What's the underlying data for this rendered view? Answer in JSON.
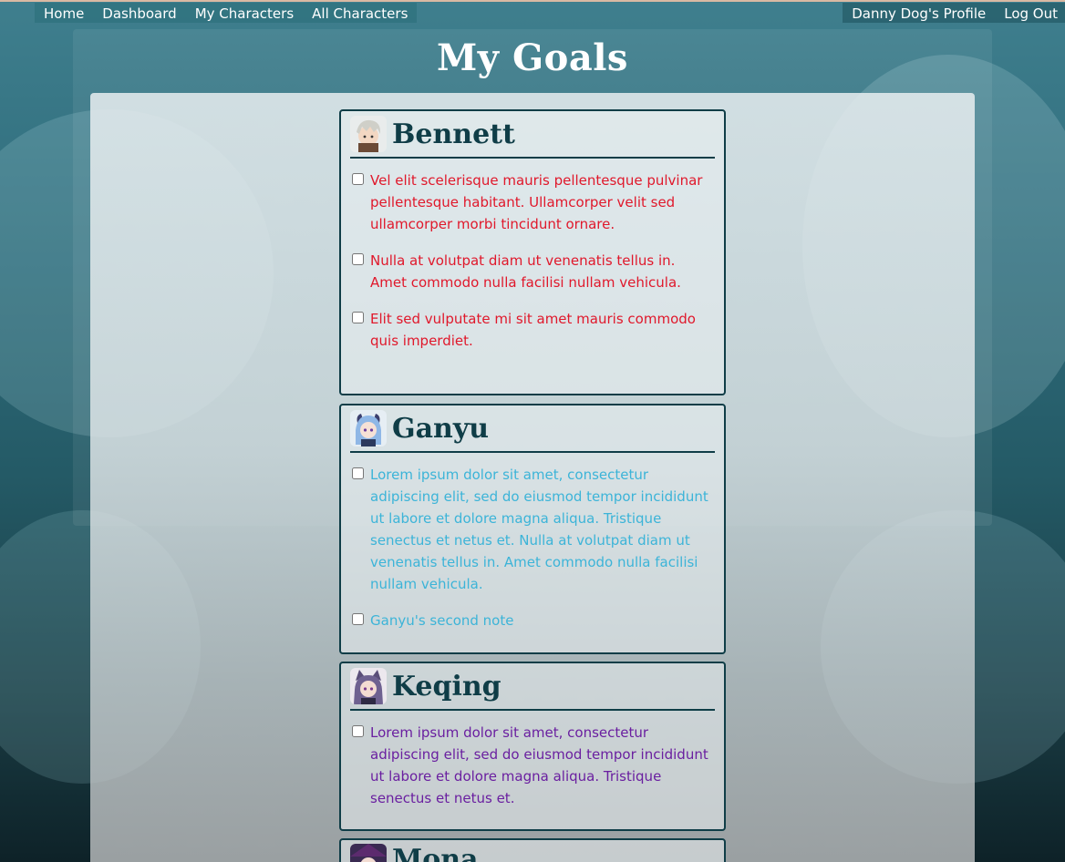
{
  "nav": {
    "left": [
      {
        "label": "Home"
      },
      {
        "label": "Dashboard"
      },
      {
        "label": "My Characters"
      },
      {
        "label": "All Characters"
      }
    ],
    "right": [
      {
        "label": "Danny Dog's Profile"
      },
      {
        "label": "Log Out"
      }
    ]
  },
  "page": {
    "title": "My Goals"
  },
  "cards": [
    {
      "name": "Bennett",
      "accent_color": "#e0182b",
      "notes": [
        {
          "text": "Vel elit scelerisque mauris pellentesque pulvinar pellentesque habitant. Ullamcorper velit sed ullamcorper morbi tincidunt ornare.",
          "checked": false
        },
        {
          "text": "Nulla at volutpat diam ut venenatis tellus in. Amet commodo nulla facilisi nullam vehicula.",
          "checked": false
        },
        {
          "text": "Elit sed vulputate mi sit amet mauris commodo quis imperdiet.",
          "checked": false
        }
      ]
    },
    {
      "name": "Ganyu",
      "accent_color": "#3cb4d8",
      "notes": [
        {
          "text": "Lorem ipsum dolor sit amet, consectetur adipiscing elit, sed do eiusmod tempor incididunt ut labore et dolore magna aliqua. Tristique senectus et netus et. Nulla at volutpat diam ut venenatis tellus in. Amet commodo nulla facilisi nullam vehicula.",
          "checked": false
        },
        {
          "text": "Ganyu's second note",
          "checked": false
        }
      ]
    },
    {
      "name": "Keqing",
      "accent_color": "#6a1fa0",
      "notes": [
        {
          "text": "Lorem ipsum dolor sit amet, consectetur adipiscing elit, sed do eiusmod tempor incididunt ut labore et dolore magna aliqua. Tristique senectus et netus et.",
          "checked": false
        }
      ]
    },
    {
      "name": "Mona",
      "accent_color": "#0f3d47",
      "notes": []
    }
  ]
}
